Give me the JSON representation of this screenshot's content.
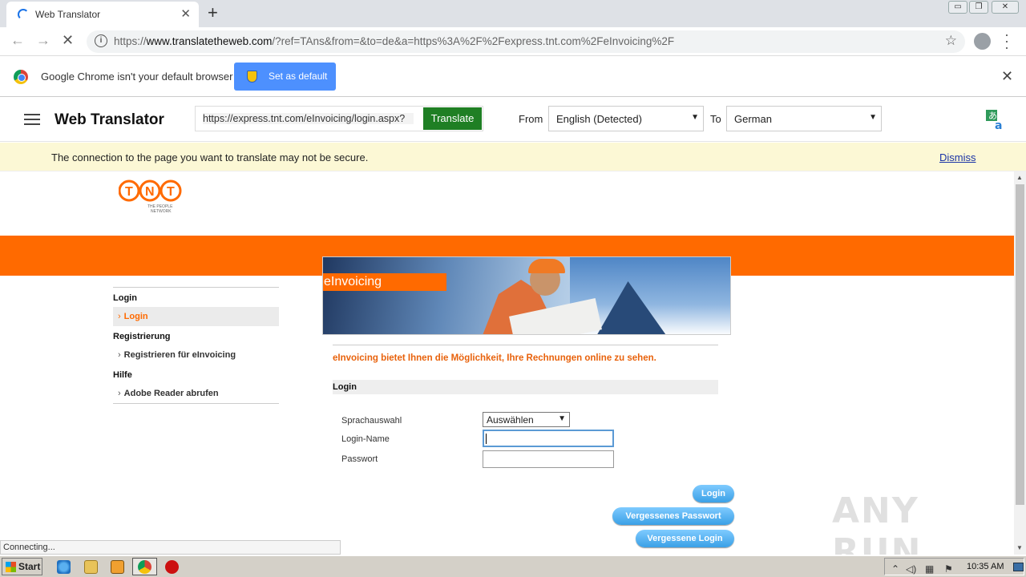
{
  "browser": {
    "tab_title": "Web Translator",
    "tab_close": "✕",
    "new_tab": "+",
    "url_prefix": "https://",
    "url_host": "www.translatetheweb.com",
    "url_rest": "/?ref=TAns&from=&to=de&a=https%3A%2F%2Fexpress.tnt.com%2FeInvoicing%2F",
    "window_controls": [
      "▭",
      "❐",
      "✕"
    ]
  },
  "infobar": {
    "message": "Google Chrome isn't your default browser",
    "set_default_label": "Set as default",
    "close": "✕"
  },
  "translator": {
    "title": "Web Translator",
    "url_value": "https://express.tnt.com/eInvoicing/login.aspx?",
    "translate_label": "Translate",
    "from_label": "From",
    "from_value": "English (Detected)",
    "to_label": "To",
    "to_value": "German",
    "select_arrow": "▼"
  },
  "security_banner": {
    "message": "The connection to the page you want to translate may not be secure.",
    "dismiss": "Dismiss"
  },
  "site": {
    "logo_text": "TNT",
    "logo_tagline_1": "THE PEOPLE",
    "logo_tagline_2": "NETWORK",
    "hero_label": "eInvoicing",
    "nav": [
      {
        "type": "heading",
        "label": "Login"
      },
      {
        "type": "item",
        "label": "Login",
        "active": true
      },
      {
        "type": "heading",
        "label": "Registrierung"
      },
      {
        "type": "item",
        "label": "Registrieren für eInvoicing",
        "active": false
      },
      {
        "type": "heading",
        "label": "Hilfe"
      },
      {
        "type": "item",
        "label": "Adobe Reader abrufen",
        "active": false
      }
    ],
    "tagline": "eInvoicing bietet Ihnen die Möglichkeit, Ihre Rechnungen online zu sehen.",
    "login_heading": "Login",
    "form": {
      "language_label": "Sprachauswahl",
      "language_value": "Auswählen",
      "login_name_label": "Login-Name",
      "password_label": "Passwort"
    },
    "buttons": {
      "login": "Login",
      "forgot_password": "Vergessenes Passwort",
      "forgot_login": "Vergessene Login"
    }
  },
  "status_text": "Connecting...",
  "watermark": "ANY RUN",
  "taskbar": {
    "start_label": "Start",
    "clock": "10:35 AM"
  },
  "colors": {
    "tnt_orange": "#ff6a00",
    "translate_green": "#1f7f24",
    "infobar_button_blue": "#4d90fe",
    "banner_yellow": "#fcf8d5"
  }
}
